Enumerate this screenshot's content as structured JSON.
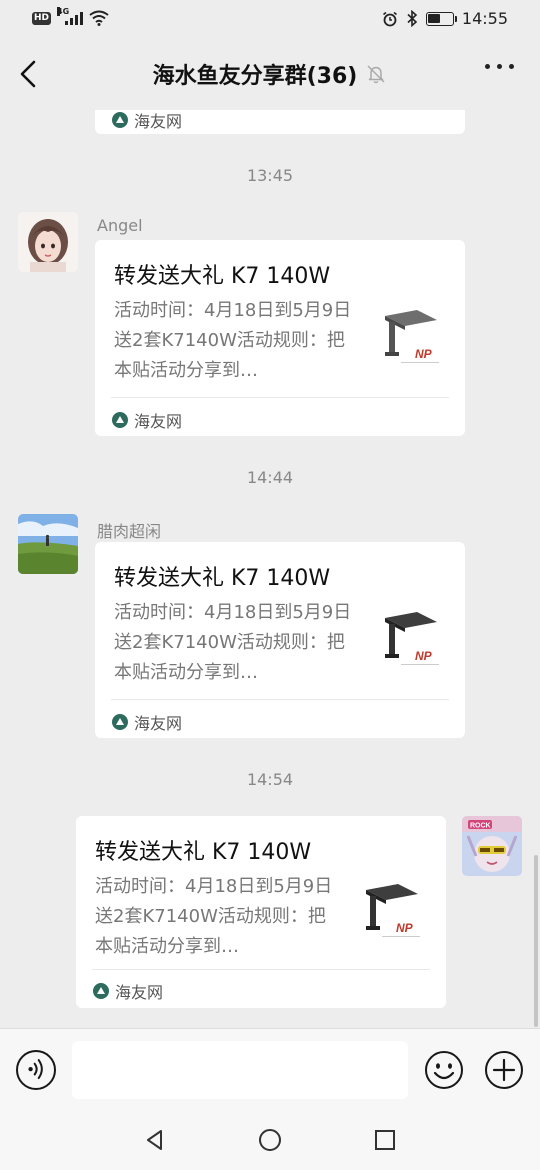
{
  "status": {
    "hd": "HD",
    "network": "4G",
    "time": "14:55",
    "battery_level": 0.5
  },
  "header": {
    "title": "海水鱼友分享群(36)"
  },
  "messages": [
    {
      "time": "13:45",
      "sender": "Angel",
      "card": {
        "title": "转发送大礼 K7 140W",
        "desc": "活动时间：4月18日到5月9日送2套K7140W活动规则：把本贴活动分享到…",
        "source": "海友网"
      }
    },
    {
      "time": "14:44",
      "sender": "腊肉超闲",
      "card": {
        "title": "转发送大礼 K7 140W",
        "desc": "活动时间：4月18日到5月9日送2套K7140W活动规则：把本贴活动分享到…",
        "source": "海友网"
      }
    },
    {
      "time": "14:54",
      "sender": "",
      "card": {
        "title": "转发送大礼 K7 140W",
        "desc": "活动时间：4月18日到5月9日送2套K7140W活动规则：把本贴活动分享到…",
        "source": "海友网"
      }
    }
  ],
  "top_partial_card": {
    "source": "海友网"
  },
  "thumb_brand": "NP",
  "avatar_self_text": "ROCK",
  "icons": {
    "back": "chevron-left-icon",
    "mute": "bell-off-icon",
    "more": "more-dots-icon",
    "voice": "voice-icon",
    "emoji": "emoji-icon",
    "plus": "plus-icon",
    "nav_back": "triangle-back-icon",
    "nav_home": "circle-home-icon",
    "nav_recent": "square-recent-icon"
  }
}
